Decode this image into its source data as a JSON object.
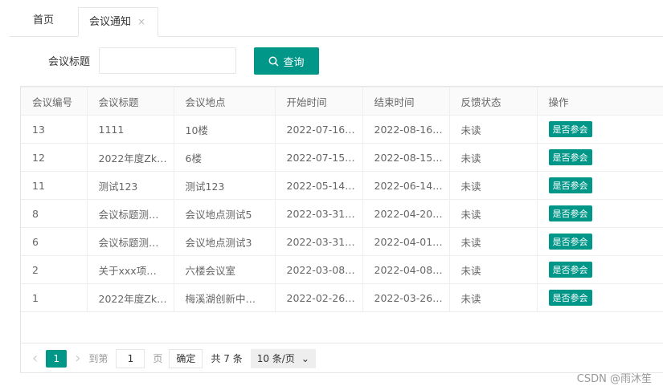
{
  "tabs": {
    "home": "首页",
    "active": "会议通知",
    "close": "×"
  },
  "search": {
    "label": "会议标题",
    "value": "",
    "button": "查询"
  },
  "table": {
    "headers": [
      "会议编号",
      "会议标题",
      "会议地点",
      "开始时间",
      "结束时间",
      "反馈状态",
      "操作"
    ],
    "rows": [
      [
        "13",
        "1111",
        "10楼",
        "2022-07-16…",
        "2022-08-16…",
        "未读",
        "是否参会"
      ],
      [
        "12",
        "2022年度Zk…",
        "6楼",
        "2022-07-15…",
        "2022-08-15…",
        "未读",
        "是否参会"
      ],
      [
        "11",
        "测试123",
        "测试123",
        "2022-05-14…",
        "2022-06-14…",
        "未读",
        "是否参会"
      ],
      [
        "8",
        "会议标题测…",
        "会议地点测试5",
        "2022-03-31…",
        "2022-04-20…",
        "未读",
        "是否参会"
      ],
      [
        "6",
        "会议标题测…",
        "会议地点测试3",
        "2022-03-31…",
        "2022-04-01…",
        "未读",
        "是否参会"
      ],
      [
        "2",
        "关于xxx项…",
        "六楼会议室",
        "2022-03-08…",
        "2022-04-08…",
        "未读",
        "是否参会"
      ],
      [
        "1",
        "2022年度Zk…",
        "梅溪湖创新中…",
        "2022-02-26…",
        "2022-03-26…",
        "未读",
        "是否参会"
      ]
    ]
  },
  "pager": {
    "prev": "‹",
    "current": "1",
    "next": "›",
    "goto": "到第",
    "page_value": "1",
    "page_unit": "页",
    "confirm": "确定",
    "total": "共 7 条",
    "size": "10 条/页"
  },
  "watermark": "CSDN @雨沐笙"
}
